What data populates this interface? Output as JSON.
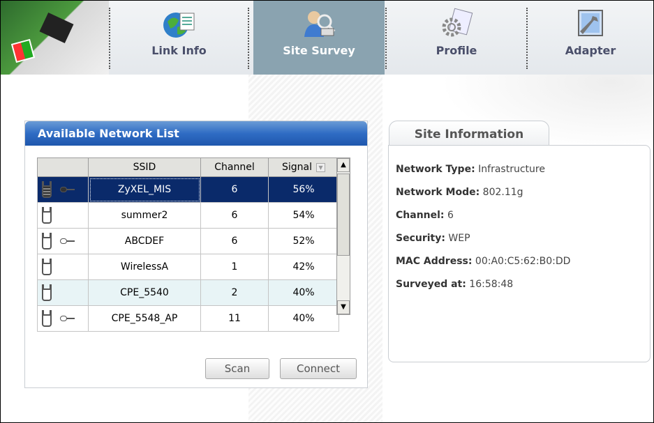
{
  "nav": {
    "tabs": [
      {
        "label": "Link Info",
        "icon": "globe-document-icon"
      },
      {
        "label": "Site Survey",
        "icon": "user-search-icon",
        "active": true
      },
      {
        "label": "Profile",
        "icon": "gear-document-icon"
      },
      {
        "label": "Adapter",
        "icon": "adapter-wrench-icon"
      }
    ]
  },
  "network_list": {
    "title": "Available Network List",
    "columns": [
      "SSID",
      "Channel",
      "Signal"
    ],
    "rows": [
      {
        "ssid": "ZyXEL_MIS",
        "channel": "6",
        "signal": "56%",
        "secured": true,
        "selected": true
      },
      {
        "ssid": "summer2",
        "channel": "6",
        "signal": "54%",
        "secured": false
      },
      {
        "ssid": "ABCDEF",
        "channel": "6",
        "signal": "52%",
        "secured": true
      },
      {
        "ssid": "WirelessA",
        "channel": "1",
        "signal": "42%",
        "secured": false
      },
      {
        "ssid": "CPE_5540",
        "channel": "2",
        "signal": "40%",
        "secured": false,
        "highlighted": true
      },
      {
        "ssid": "CPE_5548_AP",
        "channel": "11",
        "signal": "40%",
        "secured": true
      }
    ],
    "scan_label": "Scan",
    "connect_label": "Connect"
  },
  "site_info": {
    "title": "Site Information",
    "fields": [
      {
        "label": "Network Type:",
        "value": "Infrastructure"
      },
      {
        "label": "Network Mode:",
        "value": "802.11g"
      },
      {
        "label": "Channel:",
        "value": "6"
      },
      {
        "label": "Security:",
        "value": "WEP"
      },
      {
        "label": "MAC Address:",
        "value": "00:A0:C5:62:B0:DD"
      },
      {
        "label": "Surveyed at:",
        "value": "16:58:48"
      }
    ]
  },
  "colors": {
    "selected_row": "#0a2a6a",
    "title_bar": "#2f6cc4",
    "active_tab": "#8aa3b0"
  }
}
